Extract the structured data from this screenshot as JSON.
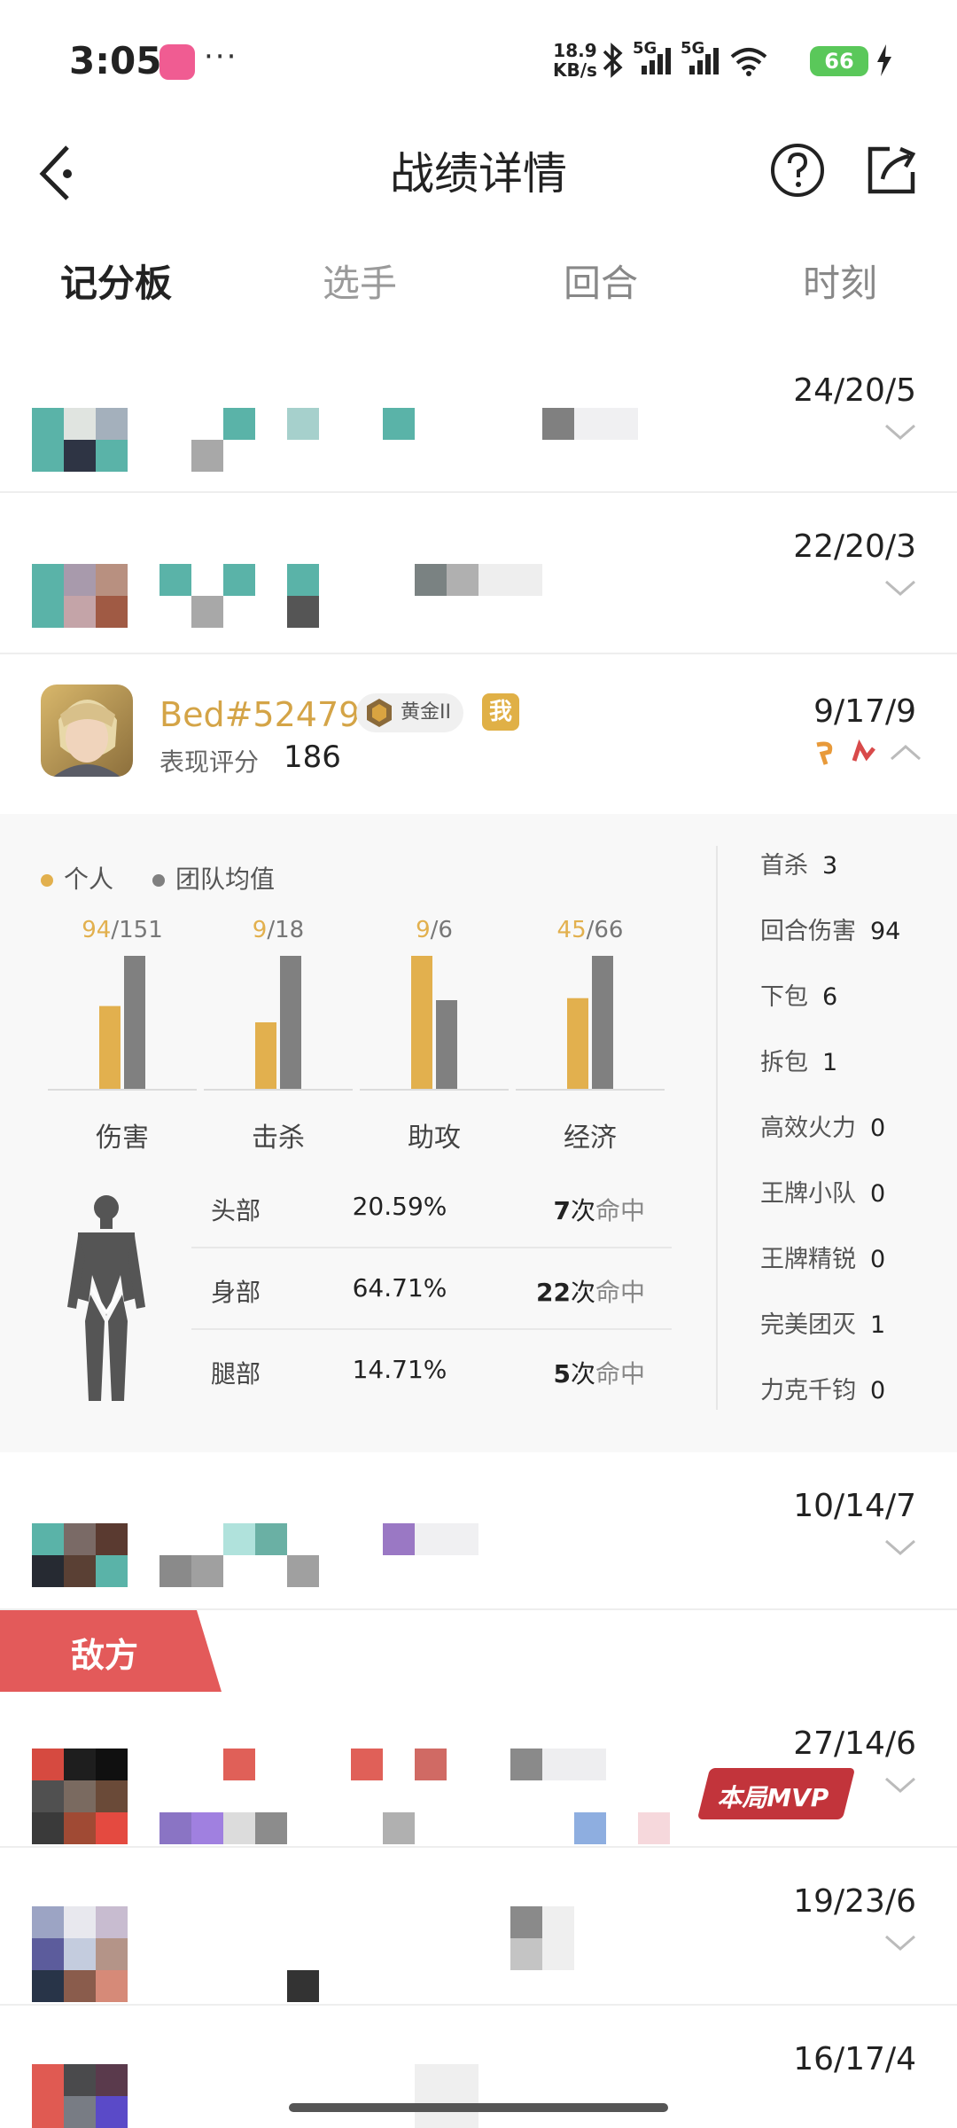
{
  "status_bar": {
    "time": "3:05",
    "net_speed_value": "18.9",
    "net_speed_unit": "KB/s",
    "net_type_1": "5G",
    "net_type_2": "5G",
    "battery": "66"
  },
  "header": {
    "title": "战绩详情",
    "back_icon": "chevron-left-icon",
    "help_icon": "help-circle-icon",
    "share_icon": "share-icon"
  },
  "tabs": [
    {
      "label": "记分板",
      "active": true
    },
    {
      "label": "选手",
      "active": false
    },
    {
      "label": "回合",
      "active": false
    },
    {
      "label": "时刻",
      "active": false
    }
  ],
  "team_rows": [
    {
      "score": "24/20/5"
    },
    {
      "score": "22/20/3"
    }
  ],
  "player": {
    "name": "Bed#52479",
    "rank": "黄金II",
    "me_badge": "我",
    "perf_label": "表现评分",
    "perf_value": "186",
    "score": "9/17/9"
  },
  "legend": {
    "personal": "个人",
    "team_avg": "团队均值",
    "personal_color": "#e2b04e",
    "team_color": "#808080"
  },
  "chart_data": {
    "type": "bar",
    "categories": [
      "伤害",
      "击杀",
      "助攻",
      "经济"
    ],
    "series": [
      {
        "name": "个人",
        "values": [
          94,
          9,
          9,
          45
        ]
      },
      {
        "name": "团队均值",
        "values": [
          151,
          18,
          6,
          66
        ]
      }
    ],
    "labels": [
      {
        "personal": "94",
        "team": "/151"
      },
      {
        "personal": "9",
        "team": "/18"
      },
      {
        "personal": "9",
        "team": "/6"
      },
      {
        "personal": "45",
        "team": "/66"
      }
    ]
  },
  "hit_stats": [
    {
      "part": "头部",
      "pct": "20.59%",
      "count": "7",
      "unit_1": "次",
      "unit_2": "命中"
    },
    {
      "part": "身部",
      "pct": "64.71%",
      "count": "22",
      "unit_1": "次",
      "unit_2": "命中"
    },
    {
      "part": "腿部",
      "pct": "14.71%",
      "count": "5",
      "unit_1": "次",
      "unit_2": "命中"
    }
  ],
  "side_stats": [
    {
      "label": "首杀",
      "value": "3"
    },
    {
      "label": "回合伤害",
      "value": "94"
    },
    {
      "label": "下包",
      "value": "6"
    },
    {
      "label": "拆包",
      "value": "1"
    },
    {
      "label": "高效火力",
      "value": "0"
    },
    {
      "label": "王牌小队",
      "value": "0"
    },
    {
      "label": "王牌精锐",
      "value": "0"
    },
    {
      "label": "完美团灭",
      "value": "1"
    },
    {
      "label": "力克千钧",
      "value": "0"
    }
  ],
  "team_row_after": {
    "score": "10/14/7"
  },
  "enemy_label": "敌方",
  "enemy_rows": [
    {
      "score": "27/14/6",
      "mvp": "本局MVP"
    },
    {
      "score": "19/23/6"
    },
    {
      "score": "16/17/4"
    }
  ]
}
